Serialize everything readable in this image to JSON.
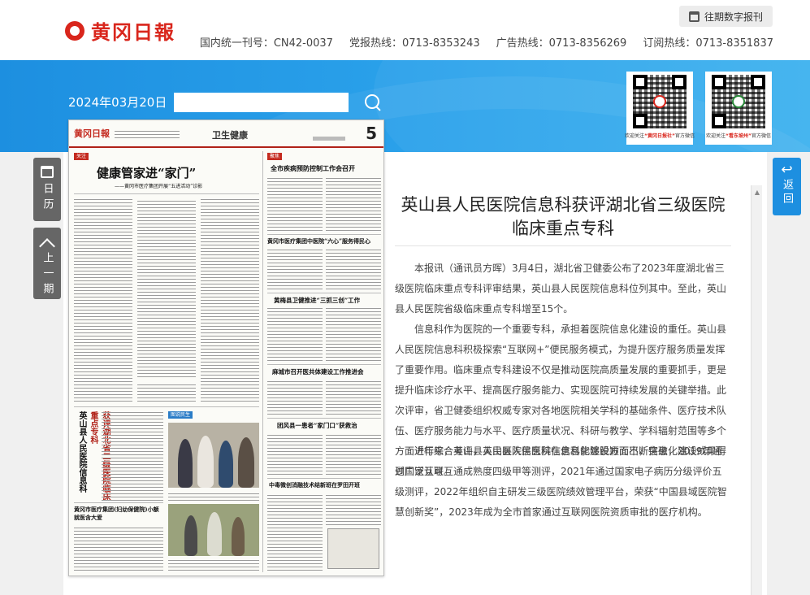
{
  "header": {
    "logo_text": "黄冈日報",
    "archive_button": "往期数字报刊",
    "hotlines": [
      "国内统一刊号：CN42-0037",
      "党报热线：0713-8353243",
      "广告热线：0713-8356269",
      "订阅热线：0713-8351837"
    ]
  },
  "banner": {
    "date": "2024年03月20日",
    "date_input_value": "",
    "qr_codes": [
      {
        "prefix": "欢迎关注",
        "name": "“黄冈日报社”",
        "suffix": "官方微信"
      },
      {
        "prefix": "欢迎关注",
        "name": "“看东坡州”",
        "suffix": "官方微信"
      }
    ]
  },
  "newspaper_page": {
    "logo": "黄冈日報",
    "section": "卫生健康",
    "page_number": "5",
    "tag_left": "关注",
    "tag_right": "聚焦",
    "tag_photo": "图说民生",
    "main_headline": "健康管家进“家门”",
    "main_subhead": "——黄冈市医疗集团开展“五进活动”诊影",
    "right_headlines": [
      "全市疾病预防控制工作会召开",
      "黄冈市医疗集团中医院“六心”服务得民心",
      "黄梅县卫健推进“三抓三创”工作",
      "麻城市召开医共体建设工作推进会",
      "团风县一患者“家门口”获救治",
      "中毒微创消融技术结新班在罗田开班"
    ],
    "vertical_headline": "获评湖北省二级医院临床重点专科",
    "vertical_headline_pre": "英山县人民医院信息科",
    "bottom_left_headline": "黄冈市医疗集团(妇幼保健院)小额就医含大爱"
  },
  "article": {
    "title": "英山县人民医院信息科获评湖北省三级医院临床重点专科",
    "paragraphs": [
      "本报讯（通讯员方晖）3月4日，湖北省卫健委公布了2023年度湖北省三级医院临床重点专科评审结果，英山县人民医院信息科位列其中。至此，英山县人民医院省级临床重点专科增至15个。",
      "信息科作为医院的一个重要专科，承担着医院信息化建设的重任。英山县人民医院信息科积极探索“互联网+”便民服务模式，为提升医疗服务质量发挥了重要作用。临床重点专科建设不仅是推动医院高质量发展的重要抓手，更是提升临床诊疗水平、提高医疗服务能力、实现医院可持续发展的关键举措。此次评审，省卫健委组织权威专家对各地医院相关学科的基础条件、医疗技术队伍、医疗服务能力与水平、医疗质量状况、科研与教学、学科辐射范围等多个方面进行综合考评，英山县人民医院信息科能够脱颖而出，信息化建设成果得到广泛认可。",
      "近年来，英山县人民医院信息科在信息化建设方面不断突破，2019年通过国家互联互通成熟度四级甲等测评，2021年通过国家电子病历分级评价五级测评，2022年组织自主研发三级医院绩效管理平台，荣获“中国县域医院智慧创新奖”，2023年成为全市首家通过互联网医院资质审批的医疗机构。"
    ]
  },
  "side": {
    "calendar_label": "日历",
    "prev_label": "上一期",
    "back_label": "返回"
  }
}
